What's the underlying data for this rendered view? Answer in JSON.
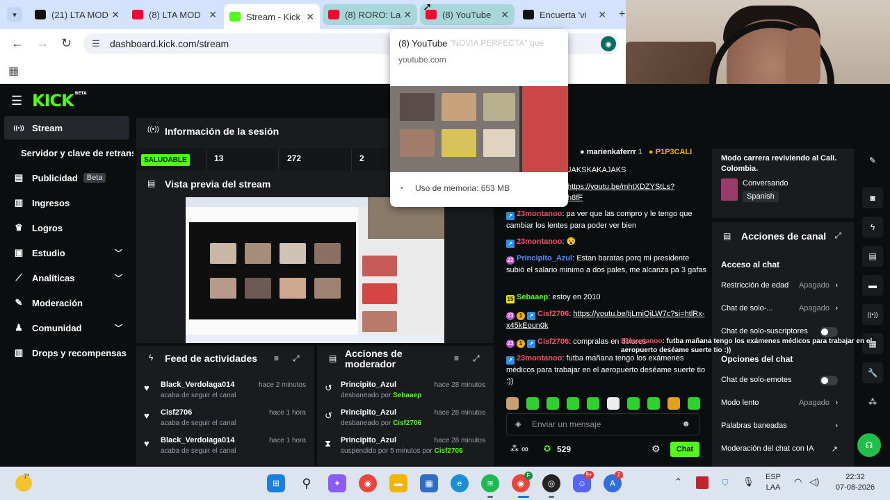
{
  "browser": {
    "tabs": [
      {
        "title": "(21) LTA MOD",
        "favicon": "x-icon",
        "color": "#111111"
      },
      {
        "title": "(8) LTA MOD",
        "favicon": "youtube-icon",
        "color": "#ff0033"
      },
      {
        "title": "Stream - Kick",
        "favicon": "kick-icon",
        "color": "#53fc18"
      },
      {
        "title": "(8) RORO: La",
        "favicon": "youtube-icon",
        "color": "#ff0033"
      },
      {
        "title": "(8) YouTube",
        "favicon": "youtube-icon",
        "color": "#ff0033"
      },
      {
        "title": "Encuerta 'vi",
        "favicon": "tiktok-icon",
        "color": "#111111"
      }
    ],
    "url": "dashboard.kick.com/stream",
    "hover_card": {
      "title": "(8) YouTube",
      "ghost_text": "\"NOVIA PERFECTA\" que",
      "domain": "youtube.com",
      "memory": "Uso de memoria: 653 MB"
    }
  },
  "kick": {
    "logo": "KICK",
    "logo_badge": "BETA",
    "sidebar": {
      "items": [
        {
          "label": "Stream",
          "icon": "stream-icon",
          "glyph": "((•))"
        },
        {
          "label": "Publicidad",
          "icon": "ad-icon",
          "glyph": "▤",
          "badge": "Beta"
        },
        {
          "label": "Ingresos",
          "icon": "income-icon",
          "glyph": "▥"
        },
        {
          "label": "Logros",
          "icon": "trophy-icon",
          "glyph": "🏆"
        },
        {
          "label": "Estudio",
          "icon": "studio-icon",
          "glyph": "▣"
        },
        {
          "label": "Analíticas",
          "icon": "analytics-icon",
          "glyph": "📈"
        },
        {
          "label": "Moderación",
          "icon": "moderation-icon",
          "glyph": "🔧"
        },
        {
          "label": "Comunidad",
          "icon": "community-icon",
          "glyph": "👥"
        },
        {
          "label": "Drops y recompensas",
          "icon": "drops-icon",
          "glyph": "▥"
        }
      ],
      "sub_item": "Servidor y clave de retransmisión"
    },
    "session": {
      "title": "Información de la sesión",
      "health": "SALUDABLE",
      "stats": [
        "13",
        "272",
        "2"
      ]
    },
    "preview": {
      "title": "Vista previa del stream"
    },
    "activity_feed": {
      "title": "Feed de actividades",
      "items": [
        {
          "name": "Black_Verdolaga014",
          "action": "acaba de seguir el canal",
          "time": "hace 2 minutos"
        },
        {
          "name": "Cisf2706",
          "action": "acaba de seguir el canal",
          "time": "hace 1 hora"
        },
        {
          "name": "Black_Verdolaga014",
          "action": "acaba de seguir el canal",
          "time": "hace 1 hora"
        }
      ]
    },
    "mod_actions": {
      "title_line1": "Acciones de",
      "title_line2": "moderador",
      "items": [
        {
          "name": "Principito_Azul",
          "action": "desbaneado por",
          "by": "Sebaaep",
          "time": "hace 28 minutos"
        },
        {
          "name": "Principito_Azul",
          "action": "desbaneado por",
          "by": "Cisf2706",
          "time": "hace 28 minutos"
        },
        {
          "name": "Principito_Azul",
          "action": "suspendido por 5 minutos por",
          "by": "Cisf2706",
          "time": "hace 28 minutos"
        }
      ]
    },
    "chat": {
      "top_users": [
        "marienkaferrr",
        "1",
        "P1P3CALI"
      ],
      "partial": "JAKSKAKAJAKS",
      "link1a": "https://youtu.be/mhtXDZYStLs?",
      "link1b": "h8fF",
      "messages": [
        {
          "user": "23montanoo",
          "color": "#ff4d6d",
          "text": "pa ver que las compro y le tengo que cambiar los lentes para poder ver bien"
        },
        {
          "user": "23montanoo",
          "color": "#ff4d6d",
          "text": "😵"
        },
        {
          "user": "Principito_Azul",
          "color": "#5b8cff",
          "text": "Estan baratas porq mi presidente subió el salario minimo a dos pales, me alcanza pa 3 gafas"
        },
        {
          "user": "Sebaaep",
          "color": "#53fc18",
          "text": "estoy en 2010"
        },
        {
          "user": "Cisf2706",
          "color": "#ff4d6d",
          "text": "https://youtu.be/tjLmiQiLW7c?si=htlRx-x45kEoun0k"
        },
        {
          "user": "Cisf2706",
          "color": "#ff4d6d",
          "text": "compralas en dolares"
        },
        {
          "user": "23montanoo",
          "color": "#ff4d6d",
          "text": "futba mañana tengo los exámenes médicos para trabajar en el aeropuerto deséame suerte tio :))"
        }
      ],
      "placeholder": "Enviar un mensaje",
      "infinity": "∞",
      "points": "529",
      "chat_button": "Chat"
    },
    "ghost_overlay": {
      "user": "23montanoo",
      "text": ": futba mañana tengo los exámenes médicos para trabajar en el aeropuerto deséame suerte tio :))"
    },
    "stream_info": {
      "title": "Modo carrera reviviendo al Cali. Colombia.",
      "category": "Conversando",
      "language": "Spanish"
    },
    "channel_actions": {
      "title": "Acciones de canal",
      "chat_access": "Acceso al chat",
      "rows": [
        {
          "label": "Restricción de edad",
          "value": "Apagado"
        },
        {
          "label": "Chat de solo-...",
          "value": "Apagado"
        }
      ],
      "subs_only": "Chat de solo-suscriptores",
      "chat_options": "Opciones del chat",
      "emotes_only": "Chat de solo-emotes",
      "slow_mode": "Modo lento",
      "slow_value": "Apagado",
      "banned_words": "Palabras baneadas",
      "ai_mod": "Moderación del chat con IA"
    }
  },
  "taskbar": {
    "weather": "7°",
    "lang1": "ESP",
    "lang2": "LAA",
    "time": "22:32",
    "date": "07-08-2026",
    "badge_f": "F",
    "badge_discord": "9+",
    "badge_store": "2"
  }
}
